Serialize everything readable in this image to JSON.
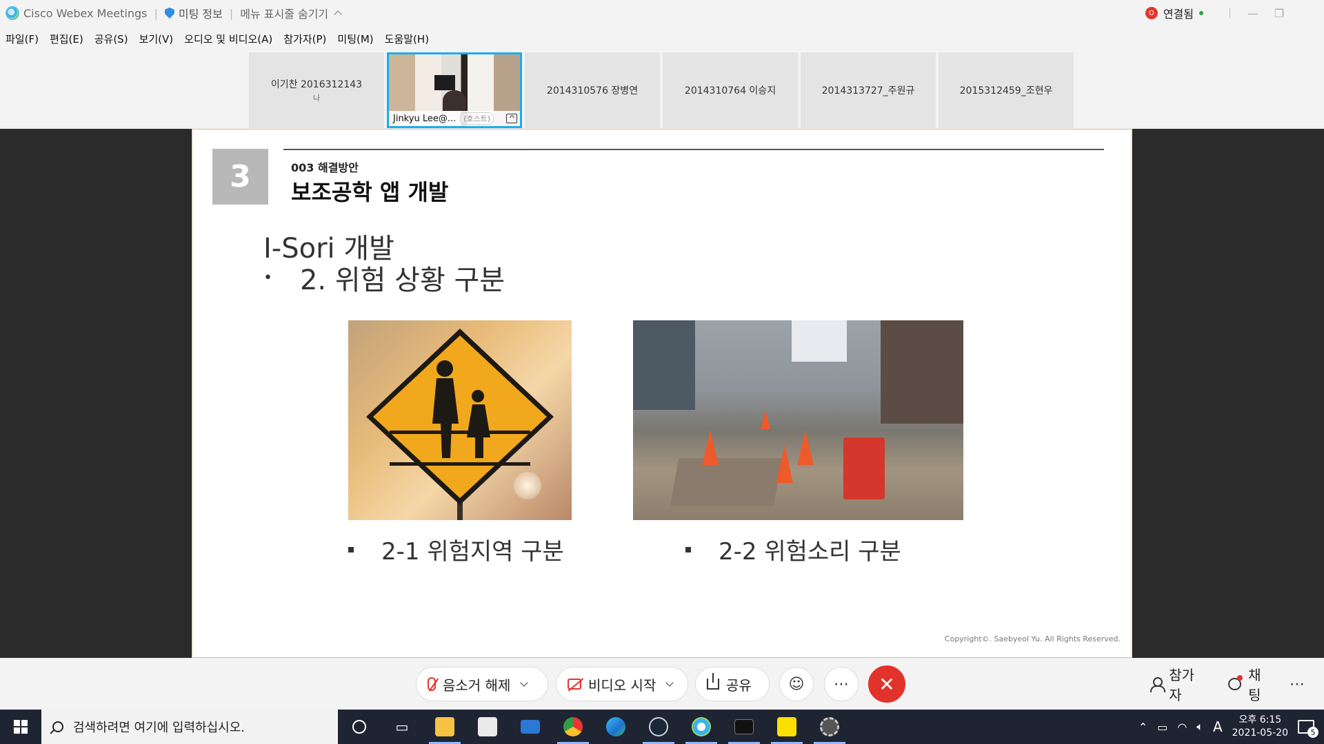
{
  "titlebar": {
    "app_name": "Cisco Webex Meetings",
    "meeting_info": "미팅 정보",
    "hide_menu": "메뉴 표시줄 숨기기",
    "connection_status": "연결됨",
    "rec_badge": "O"
  },
  "menubar": {
    "items": [
      "파일(F)",
      "편집(E)",
      "공유(S)",
      "보기(V)",
      "오디오 및 비디오(A)",
      "참가자(P)",
      "미팅(M)",
      "도움말(H)"
    ]
  },
  "participants": [
    {
      "name": "이기찬 2016312143",
      "sub": "나"
    },
    {
      "name": "Jinkyu Lee@...",
      "tag": "(호스트)"
    },
    {
      "name": "2014310576 장병연"
    },
    {
      "name": "2014310764 이승지"
    },
    {
      "name": "2014313727_주원규"
    },
    {
      "name": "2015312459_조현우"
    }
  ],
  "slide": {
    "number": "3",
    "subhead": "003 해결방안",
    "headline": "보조공학 앱 개발",
    "title": "I-Sori 개발",
    "bullet": "2. 위험 상황 구분",
    "caption1": "2-1 위험지역 구분",
    "caption2": "2-2 위험소리 구분",
    "copyright": "Copyright©. Saebyeol Yu. All Rights Reserved."
  },
  "controls": {
    "unmute": "음소거 해제",
    "start_video": "비디오 시작",
    "share": "공유",
    "participants": "참가자",
    "chat": "채팅",
    "end_color": "#e1332b"
  },
  "taskbar": {
    "search_placeholder": "검색하려면 여기에 입력하십시오.",
    "ime": "A",
    "time": "오후 6:15",
    "date": "2021-05-20",
    "notifications": "5"
  }
}
